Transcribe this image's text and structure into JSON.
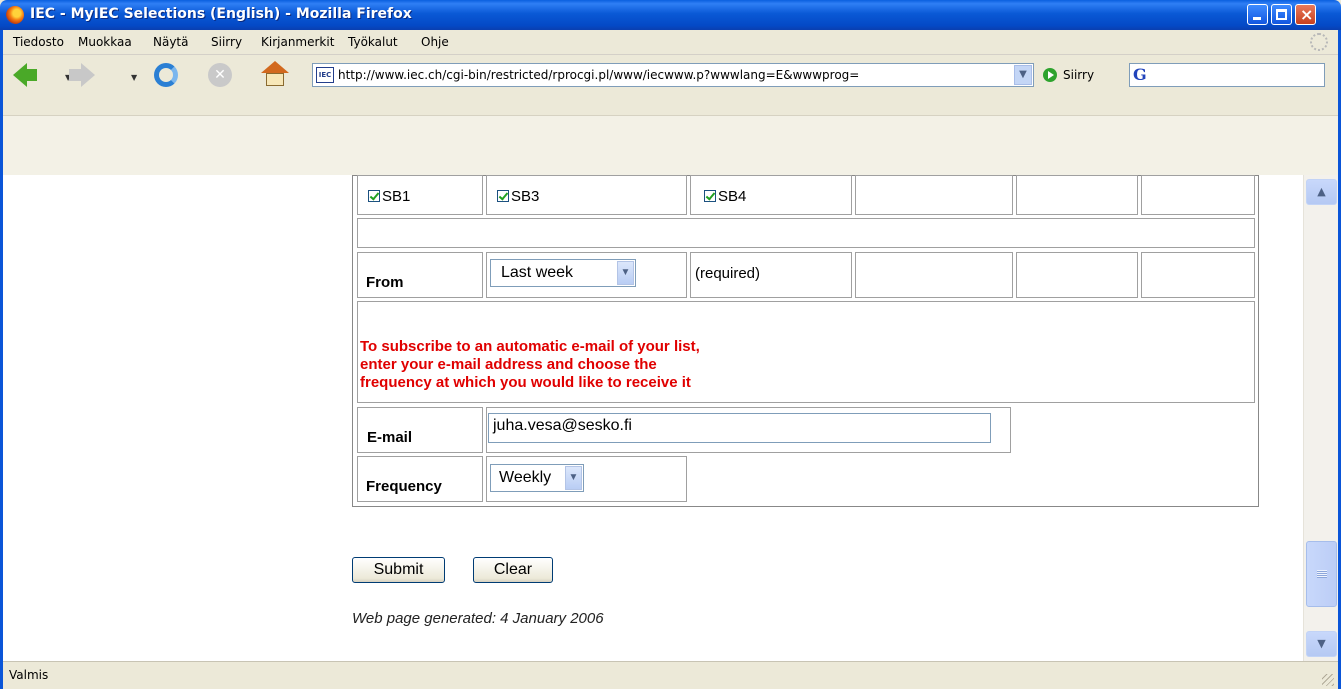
{
  "window": {
    "title": "IEC - MyIEC Selections (English) - Mozilla Firefox",
    "minimize_label": "",
    "maximize_label": "",
    "close_label": "×"
  },
  "menu": {
    "items": [
      "Tiedosto",
      "Muokkaa",
      "Näytä",
      "Siirry",
      "Kirjanmerkit",
      "Työkalut",
      "Ohje"
    ]
  },
  "toolbar": {
    "url": "http://www.iec.ch/cgi-bin/restricted/rprocgi.pl/www/iecwww.p?wwwlang=E&wwwprog=",
    "site_icon": "IEC",
    "go_label": "Siirry",
    "search_engine_icon": "G",
    "icons": [
      "back-icon",
      "forward-icon",
      "reload-icon",
      "stop-icon",
      "home-icon"
    ]
  },
  "form": {
    "checkboxes": [
      {
        "label": "SB1",
        "checked": true
      },
      {
        "label": "SB3",
        "checked": true
      },
      {
        "label": "SB4",
        "checked": true
      }
    ],
    "from_label": "From",
    "from_value": "Last week",
    "required_note": "(required)",
    "notice_lines": [
      "To subscribe to an automatic e-mail of your list,",
      "enter your e-mail address and choose the",
      "frequency at which you would like to receive it"
    ],
    "email_label": "E-mail",
    "email_value": "juha.vesa@sesko.fi",
    "frequency_label": "Frequency",
    "frequency_value": "Weekly",
    "submit_label": "Submit",
    "clear_label": "Clear",
    "footer": "Web page generated: 4 January 2006"
  },
  "status": {
    "text": "Valmis"
  },
  "colors": {
    "titlebar": "#0a59d6",
    "notice": "#e00000",
    "checkmark": "#21a121"
  }
}
